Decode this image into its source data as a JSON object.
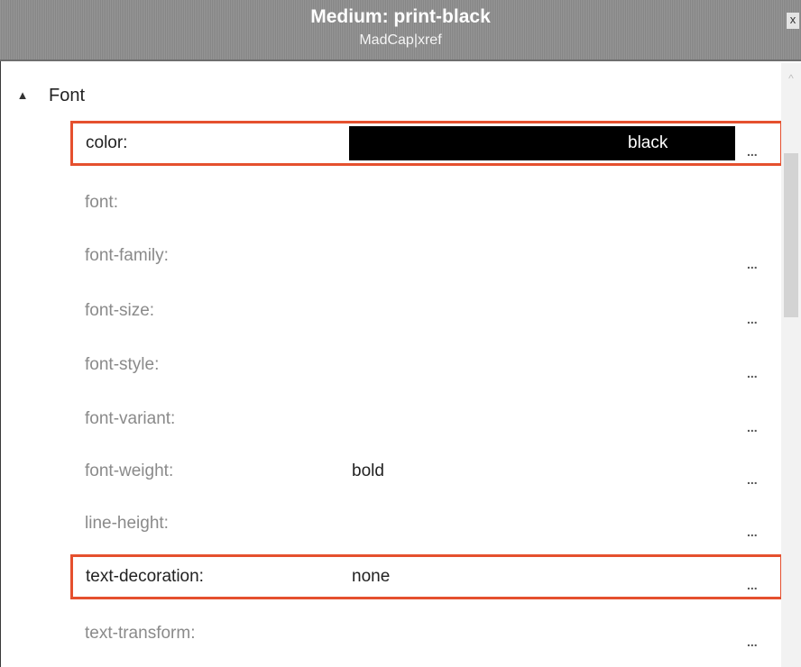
{
  "window": {
    "title": "Medium: print-black",
    "subtitle": "MadCap|xref",
    "close_label": "x"
  },
  "group": {
    "expander_icon": "▲",
    "label": "Font"
  },
  "properties": [
    {
      "name": "color:",
      "value": "black",
      "value_style": "black-swatch",
      "highlighted": true,
      "has_button": true
    },
    {
      "name": "font:",
      "value": "",
      "highlighted": false,
      "has_button": false
    },
    {
      "name": "font-family:",
      "value": "",
      "highlighted": false,
      "has_button": true
    },
    {
      "name": "font-size:",
      "value": "",
      "highlighted": false,
      "has_button": true
    },
    {
      "name": "font-style:",
      "value": "",
      "highlighted": false,
      "has_button": true
    },
    {
      "name": "font-variant:",
      "value": "",
      "highlighted": false,
      "has_button": true
    },
    {
      "name": "font-weight:",
      "value": "bold",
      "highlighted": false,
      "has_button": true
    },
    {
      "name": "line-height:",
      "value": "",
      "highlighted": false,
      "has_button": true
    },
    {
      "name": "text-decoration:",
      "value": "none",
      "highlighted": true,
      "has_button": true
    },
    {
      "name": "text-transform:",
      "value": "",
      "highlighted": false,
      "has_button": true
    }
  ],
  "ellipsis_label": "...",
  "scrollbar": {
    "up_arrow": "^"
  },
  "colors": {
    "titlebar": "#8d8d8d",
    "highlight_border": "#e5502e",
    "active_text": "#222222",
    "inactive_text": "#8a8a8a",
    "color_swatch": "#000000"
  }
}
